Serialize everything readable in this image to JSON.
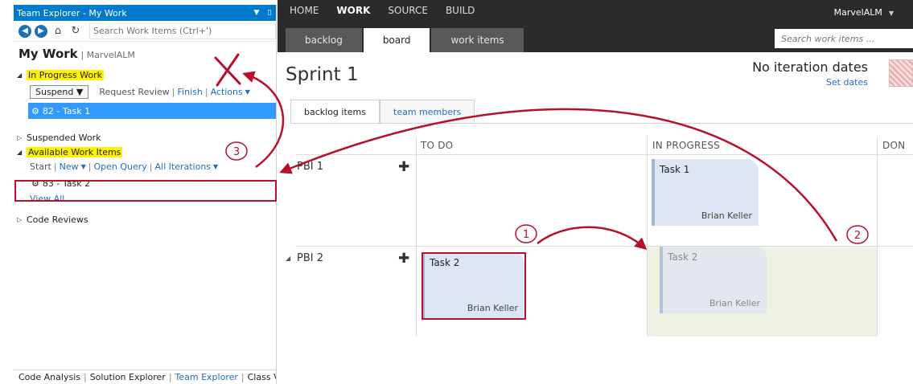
{
  "team_explorer": {
    "title": "Team Explorer - My Work",
    "search_placeholder": "Search Work Items (Ctrl+')",
    "header_title": "My Work",
    "header_sub": "MarvelALM",
    "in_progress": {
      "label": "In Progress Work",
      "suspend": "Suspend",
      "request_review": "Request Review",
      "finish": "Finish",
      "actions": "Actions",
      "item": "82 - Task 1"
    },
    "suspended": {
      "label": "Suspended Work"
    },
    "available": {
      "label": "Available Work Items",
      "start": "Start",
      "new": "New",
      "open_query": "Open Query",
      "all_iterations": "All Iterations",
      "item": "83 - Task 2",
      "view_all": "View All"
    },
    "code_reviews": {
      "label": "Code Reviews"
    },
    "bottom_tabs": [
      "Code Analysis",
      "Solution Explorer",
      "Team Explorer",
      "Class View"
    ]
  },
  "web": {
    "nav": [
      "HOME",
      "WORK",
      "SOURCE",
      "BUILD"
    ],
    "account": "MarvelALM",
    "subtabs": [
      "backlog",
      "board",
      "work items"
    ],
    "search_placeholder": "Search work items ...",
    "sprint": "Sprint 1",
    "iteration_text": "No iteration dates",
    "set_dates": "Set dates",
    "board_tabs": [
      "backlog items",
      "team members"
    ],
    "columns": [
      "TO DO",
      "IN PROGRESS",
      "DON"
    ],
    "rows": [
      {
        "name": "PBI 1"
      },
      {
        "name": "PBI 2"
      }
    ],
    "cards": {
      "task1": {
        "title": "Task 1",
        "assignee": "Brian Keller"
      },
      "task2": {
        "title": "Task 2",
        "assignee": "Brian Keller"
      },
      "task2_ghost": {
        "title": "Task 2",
        "assignee": "Brian Keller"
      }
    }
  },
  "annotations": {
    "callouts": [
      "1",
      "2",
      "3"
    ],
    "colors": {
      "arrow": "#b8102a",
      "highlight": "#fff200",
      "selection": "#3399ff"
    }
  }
}
